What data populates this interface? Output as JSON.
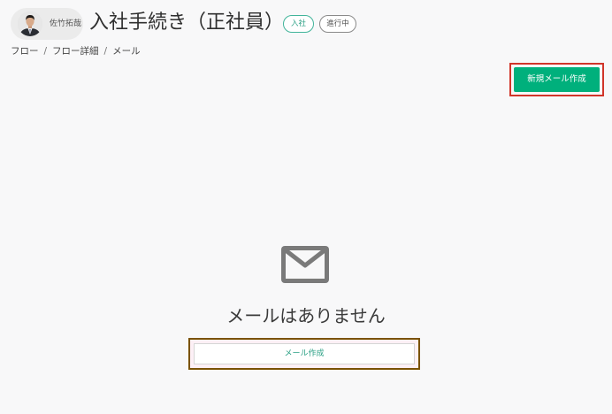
{
  "header": {
    "user_name": "佐竹拓哉",
    "title": "入社手続き（正社員）",
    "tags": [
      {
        "label": "入社",
        "color": "#41b49a"
      },
      {
        "label": "進行中",
        "color": "#8a8a8a"
      }
    ]
  },
  "breadcrumb": {
    "items": [
      "フロー",
      "フロー詳細",
      "メール"
    ],
    "separator": "/"
  },
  "toolbar": {
    "new_mail_label": "新規メール作成",
    "new_mail_color": "#00b07c",
    "highlight_color": "#d1352a"
  },
  "empty_state": {
    "icon": "mail-icon",
    "message": "メールはありません",
    "compose_label": "メール作成",
    "compose_color": "#2a9f84"
  }
}
